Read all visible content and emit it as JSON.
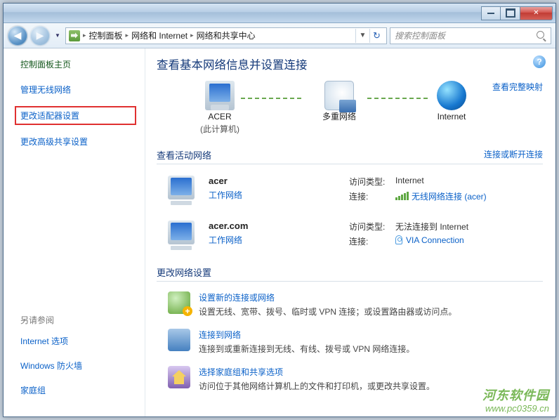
{
  "titlebar": {
    "min": "",
    "max": "",
    "close": "✕"
  },
  "navbar": {
    "back": "◀",
    "fwd": "▶",
    "drop": "▼",
    "addr_sep": "▸",
    "breadcrumb": [
      "控制面板",
      "网络和 Internet",
      "网络和共享中心"
    ],
    "addr_drop": "▼",
    "refresh": "↻",
    "search_placeholder": "搜索控制面板"
  },
  "sidebar": {
    "home": "控制面板主页",
    "links": [
      "管理无线网络",
      "更改适配器设置",
      "更改高级共享设置"
    ],
    "seealso_head": "另请参阅",
    "seealso": [
      "Internet 选项",
      "Windows 防火墙",
      "家庭组"
    ]
  },
  "main": {
    "help": "?",
    "title": "查看基本网络信息并设置连接",
    "map": {
      "acer_label": "ACER",
      "acer_sub": "(此计算机)",
      "multi_label": "多重网络",
      "inet_label": "Internet",
      "full_map_link": "查看完整映射"
    },
    "active": {
      "heading": "查看活动网络",
      "right_link": "连接或断开连接",
      "nets": [
        {
          "name": "acer",
          "type": "工作网络",
          "access_label": "访问类型:",
          "access_val": "Internet",
          "conn_label": "连接:",
          "conn_val": "无线网络连接 (acer)",
          "icon": "wifi"
        },
        {
          "name": "acer.com",
          "type": "工作网络",
          "access_label": "访问类型:",
          "access_val": "无法连接到 Internet",
          "conn_label": "连接:",
          "conn_val": "VIA Connection",
          "icon": "via"
        }
      ]
    },
    "change": {
      "heading": "更改网络设置",
      "items": [
        {
          "title": "设置新的连接或网络",
          "desc": "设置无线、宽带、拨号、临时或 VPN 连接；或设置路由器或访问点。",
          "icon": "new"
        },
        {
          "title": "连接到网络",
          "desc": "连接到或重新连接到无线、有线、拨号或 VPN 网络连接。",
          "icon": "conn"
        },
        {
          "title": "选择家庭组和共享选项",
          "desc": "访问位于其他网络计算机上的文件和打印机，或更改共享设置。",
          "icon": "home"
        }
      ]
    }
  },
  "watermark": {
    "line1": "河东软件园",
    "line2": "www.pc0359.cn"
  }
}
